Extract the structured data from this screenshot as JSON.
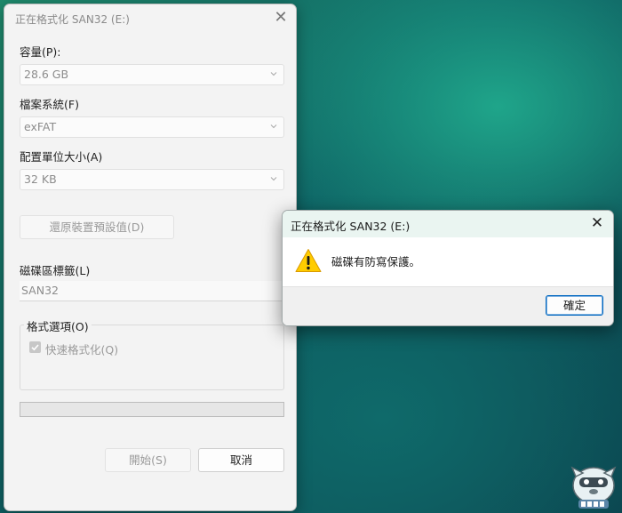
{
  "format_dialog": {
    "title": "正在格式化 SAN32 (E:)",
    "capacity": {
      "label": "容量(P):",
      "value": "28.6 GB"
    },
    "filesystem": {
      "label": "檔案系統(F)",
      "value": "exFAT"
    },
    "allocation": {
      "label": "配置單位大小(A)",
      "value": "32 KB"
    },
    "restore_defaults_label": "還原裝置預設值(D)",
    "volume_label": {
      "label": "磁碟區標籤(L)",
      "value": "SAN32"
    },
    "format_options": {
      "title": "格式選項(O)",
      "quick_format_label": "快速格式化(Q)",
      "quick_format_checked": true
    },
    "progress": 0,
    "start_label": "開始(S)",
    "cancel_label": "取消"
  },
  "message_box": {
    "title": "正在格式化 SAN32 (E:)",
    "icon": "warning-icon",
    "message": "磁碟有防寫保護。",
    "ok_label": "確定"
  },
  "colors": {
    "accent": "#0067c0",
    "warning": "#ffcc00",
    "desktop": "#0d5f62"
  }
}
